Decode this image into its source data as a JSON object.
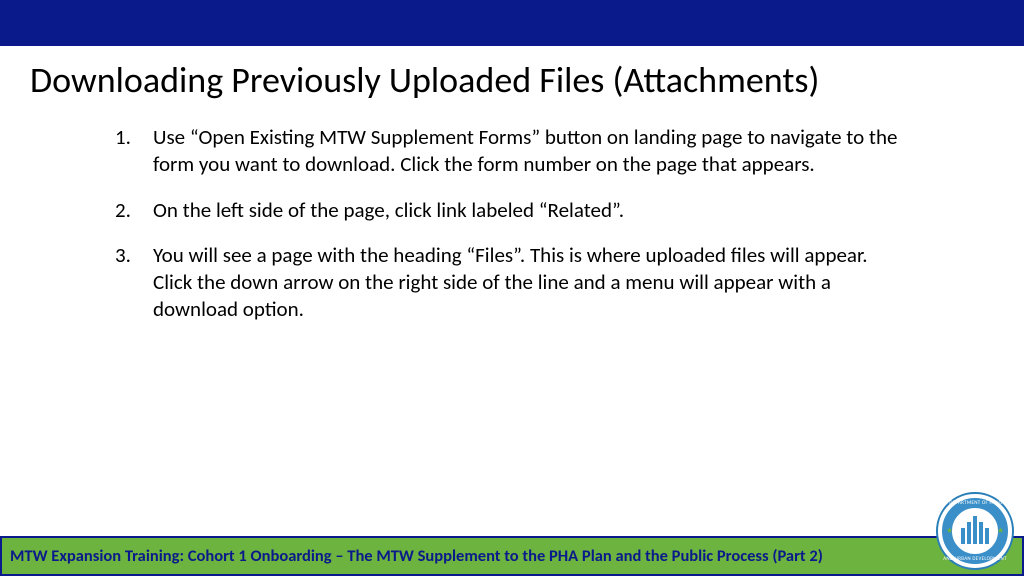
{
  "title": "Downloading Previously Uploaded Files (Attachments)",
  "steps": [
    "Use “Open Existing MTW Supplement Forms” button on landing page to navigate to the form you want to download. Click the form number on the page that appears.",
    "On the left side of the page, click link labeled “Related”.",
    "You will see a page with the heading “Files”. This is where uploaded files will appear. Click the down arrow on the right side of the line and a menu will appear with a download option."
  ],
  "footer": "MTW Expansion Training: Cohort 1 Onboarding – The MTW Supplement to the PHA Plan and the Public Process (Part 2)",
  "seal": {
    "top": "U.S. DEPARTMENT OF HOUSING",
    "bottom": "AND URBAN DEVELOPMENT"
  }
}
